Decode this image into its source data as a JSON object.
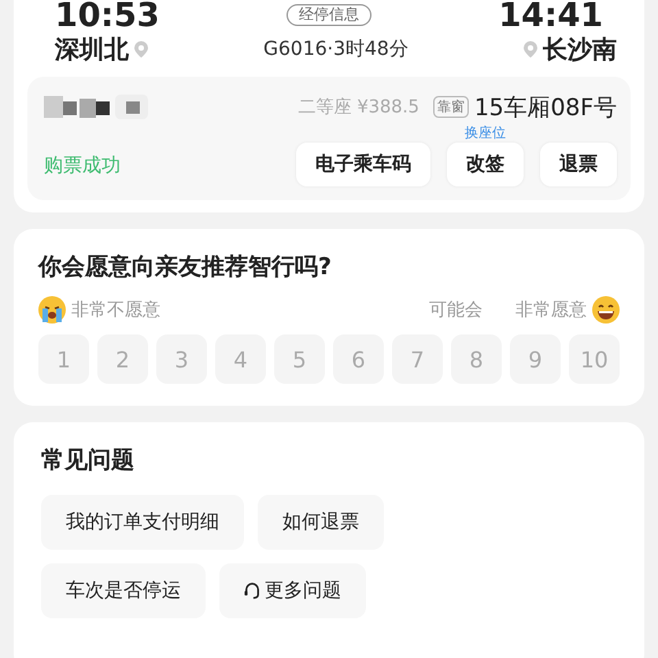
{
  "trip": {
    "depart_time": "10:53",
    "arrive_time": "14:41",
    "stop_info": "经停信息",
    "from": "深圳北",
    "to": "长沙南",
    "train": "G6016·3时48分"
  },
  "ticket": {
    "seat_class": "二等座 ¥388.5",
    "seat_tag": "靠窗",
    "seat": "15车厢08F号",
    "status": "购票成功",
    "hint": "换座位",
    "actions": [
      "电子乘车码",
      "改签",
      "退票"
    ]
  },
  "survey": {
    "question": "你会愿意向亲友推荐智行吗?",
    "low": "非常不愿意",
    "mid": "可能会",
    "high": "非常愿意",
    "scores": [
      {
        "label": "1",
        "selected": false
      },
      {
        "label": "2",
        "selected": false
      },
      {
        "label": "3",
        "selected": false
      },
      {
        "label": "4",
        "selected": false
      },
      {
        "label": "5",
        "selected": false
      },
      {
        "label": "6",
        "selected": false
      },
      {
        "label": "7",
        "selected": false
      },
      {
        "label": "8",
        "selected": false
      },
      {
        "label": "9",
        "selected": false
      },
      {
        "label": "10",
        "selected": false
      }
    ]
  },
  "faq": {
    "title": "常见问题",
    "items": [
      {
        "label": "我的订单支付明细",
        "kind": "text"
      },
      {
        "label": "如何退票",
        "kind": "text"
      },
      {
        "label": "车次是否停运",
        "kind": "text"
      },
      {
        "label": "更多问题",
        "kind": "support"
      }
    ]
  }
}
